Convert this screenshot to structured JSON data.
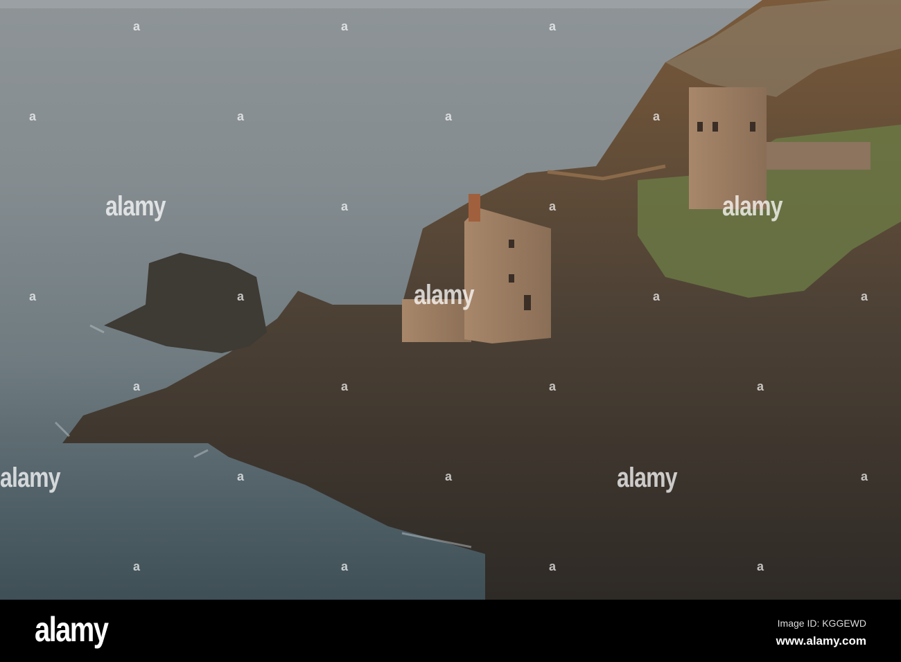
{
  "watermark": {
    "brand": "alamy",
    "mark": "a"
  },
  "footer": {
    "logo": "alamy",
    "image_id": "Image ID: KGGEWD",
    "url": "www.alamy.com"
  }
}
